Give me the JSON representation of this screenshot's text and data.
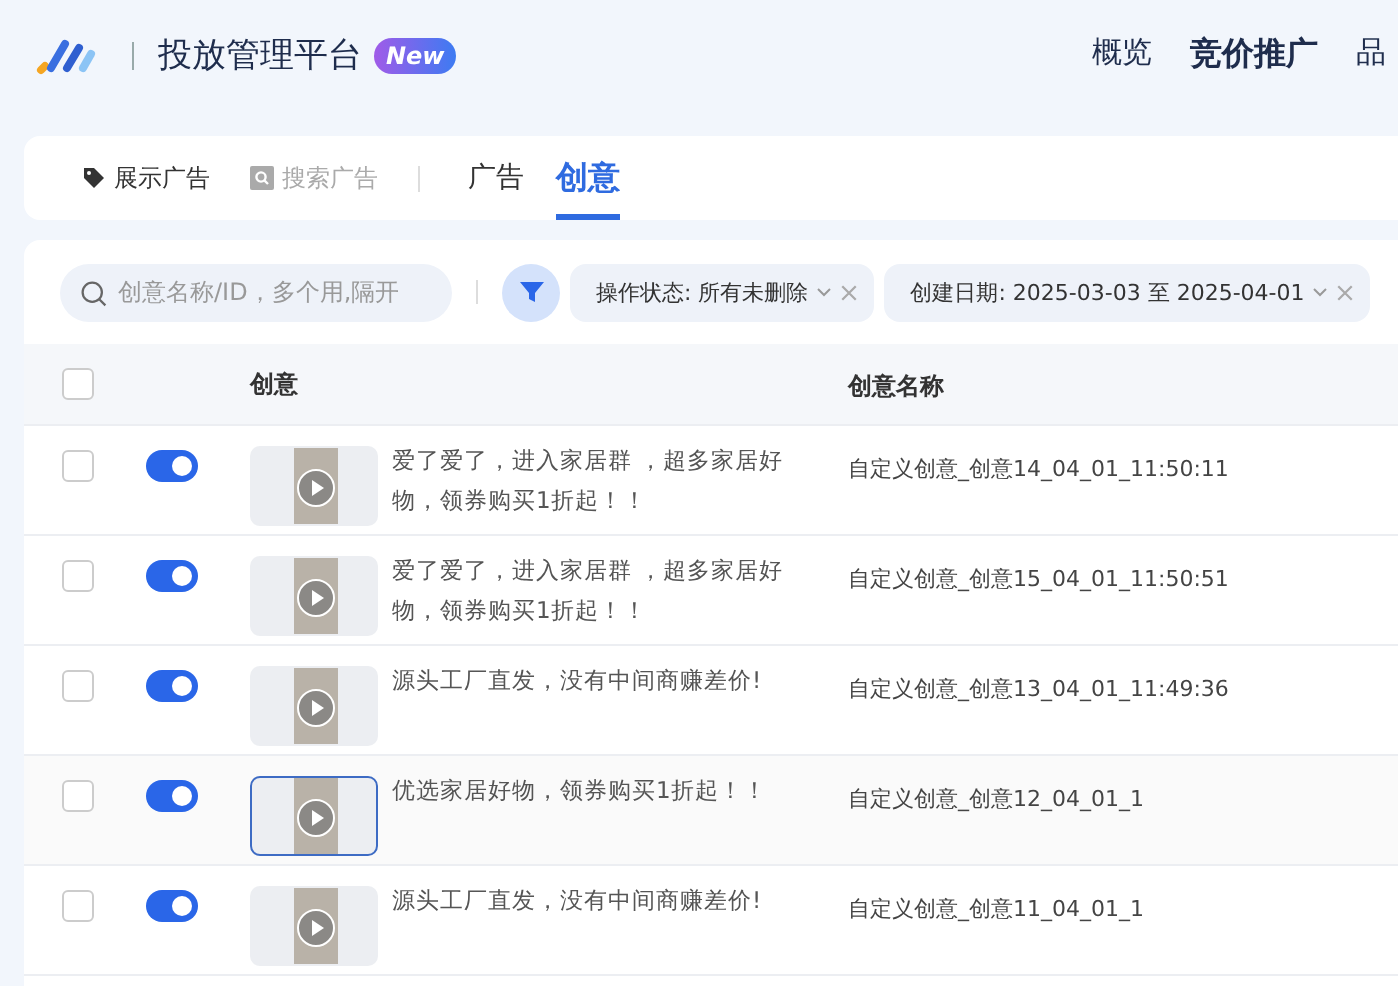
{
  "header": {
    "title": "投放管理平台",
    "badge": "New",
    "nav": [
      {
        "label": "概览",
        "selected": false
      },
      {
        "label": "竞价推广",
        "selected": true
      },
      {
        "label": "品",
        "selected": false
      }
    ]
  },
  "ad_types": [
    {
      "label": "展示广告",
      "selected": true,
      "kind": "tag"
    },
    {
      "label": "搜索广告",
      "selected": false,
      "kind": "search"
    }
  ],
  "tabs": [
    {
      "label": "广告",
      "selected": false
    },
    {
      "label": "创意",
      "selected": true
    }
  ],
  "search": {
    "placeholder": "创意名称/ID，多个用,隔开"
  },
  "filters": [
    {
      "label": "操作状态: 所有未删除"
    },
    {
      "label": "创建日期: 2025-03-03 至 2025-04-01"
    }
  ],
  "table": {
    "select_all": {
      "checked": false
    },
    "columns": [
      "创意",
      "创意名称"
    ],
    "rows": [
      {
        "checked": false,
        "on": true,
        "hovered": false,
        "text": "爱了爱了，进入家居群 ，超多家居好物，领券购买1折起！！",
        "name": "自定义创意_创意14_04_01_11:50:11"
      },
      {
        "checked": false,
        "on": true,
        "hovered": false,
        "text": "爱了爱了，进入家居群 ，超多家居好物，领券购买1折起！！",
        "name": "自定义创意_创意15_04_01_11:50:51"
      },
      {
        "checked": false,
        "on": true,
        "hovered": false,
        "text": "源头工厂直发，没有中间商赚差价!",
        "name": "自定义创意_创意13_04_01_11:49:36"
      },
      {
        "checked": false,
        "on": true,
        "hovered": true,
        "text": "优选家居好物，领券购买1折起！！",
        "name": "自定义创意_创意12_04_01_1"
      },
      {
        "checked": false,
        "on": true,
        "hovered": false,
        "text": "源头工厂直发，没有中间商赚差价!",
        "name": "自定义创意_创意11_04_01_1"
      }
    ]
  }
}
